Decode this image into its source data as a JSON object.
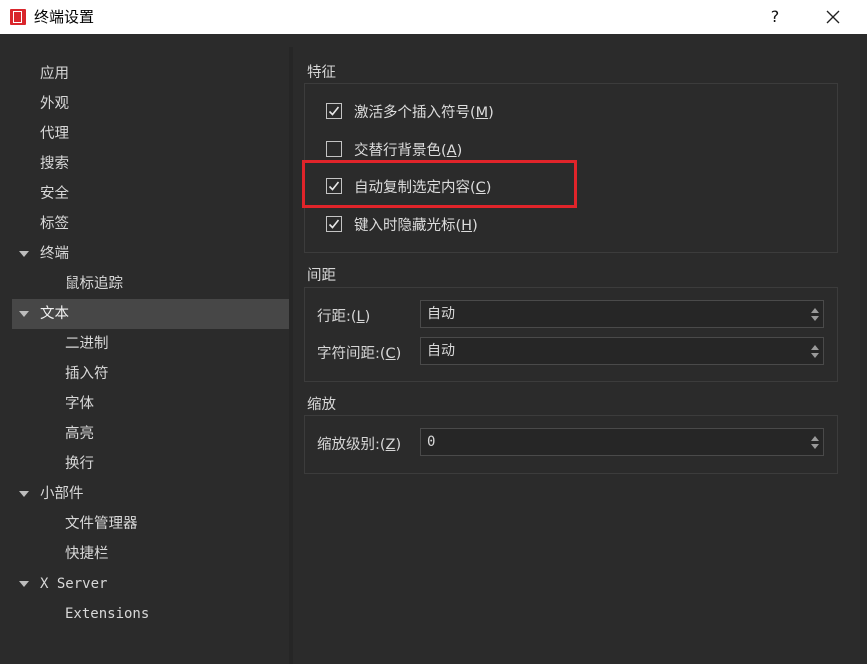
{
  "window": {
    "title": "终端设置",
    "help_button": "?",
    "close_icon": "close-icon",
    "app_icon": "red-document-icon"
  },
  "sidebar": {
    "items": [
      {
        "label": "应用",
        "level": 0
      },
      {
        "label": "外观",
        "level": 0
      },
      {
        "label": "代理",
        "level": 0
      },
      {
        "label": "搜索",
        "level": 0
      },
      {
        "label": "安全",
        "level": 0
      },
      {
        "label": "标签",
        "level": 0
      },
      {
        "label": "终端",
        "level": 0,
        "expanded": true
      },
      {
        "label": "鼠标追踪",
        "level": 1
      },
      {
        "label": "文本",
        "level": 0,
        "expanded": true,
        "selected": true
      },
      {
        "label": "二进制",
        "level": 1
      },
      {
        "label": "插入符",
        "level": 1
      },
      {
        "label": "字体",
        "level": 1
      },
      {
        "label": "高亮",
        "level": 1
      },
      {
        "label": "换行",
        "level": 1
      },
      {
        "label": "小部件",
        "level": 0,
        "expanded": true
      },
      {
        "label": "文件管理器",
        "level": 1
      },
      {
        "label": "快捷栏",
        "level": 1
      },
      {
        "label": "X Server",
        "level": 0,
        "expanded": true
      },
      {
        "label": "Extensions",
        "level": 1
      }
    ]
  },
  "features": {
    "title": "特征",
    "checkboxes": [
      {
        "text": "激活多个插入符号(",
        "key": "M",
        "end": ")",
        "checked": true
      },
      {
        "text": "交替行背景色(",
        "key": "A",
        "end": ")",
        "checked": false
      },
      {
        "text": "自动复制选定内容(",
        "key": "C",
        "end": ")",
        "checked": true,
        "highlighted": true
      },
      {
        "text": "键入时隐藏光标(",
        "key": "H",
        "end": ")",
        "checked": true
      }
    ]
  },
  "spacing": {
    "title": "间距",
    "line_label": "行距:(",
    "line_key": "L",
    "line_end": ")",
    "line_value": "自动",
    "char_label": "字符间距:(",
    "char_key": "C",
    "char_end": ")",
    "char_value": "自动"
  },
  "zoom": {
    "title": "缩放",
    "label": "缩放级别:(",
    "key": "Z",
    "end": ")",
    "value": "0"
  },
  "colors": {
    "background": "#2b2b2b",
    "selected": "#474747",
    "highlight_border": "#e0242a"
  }
}
